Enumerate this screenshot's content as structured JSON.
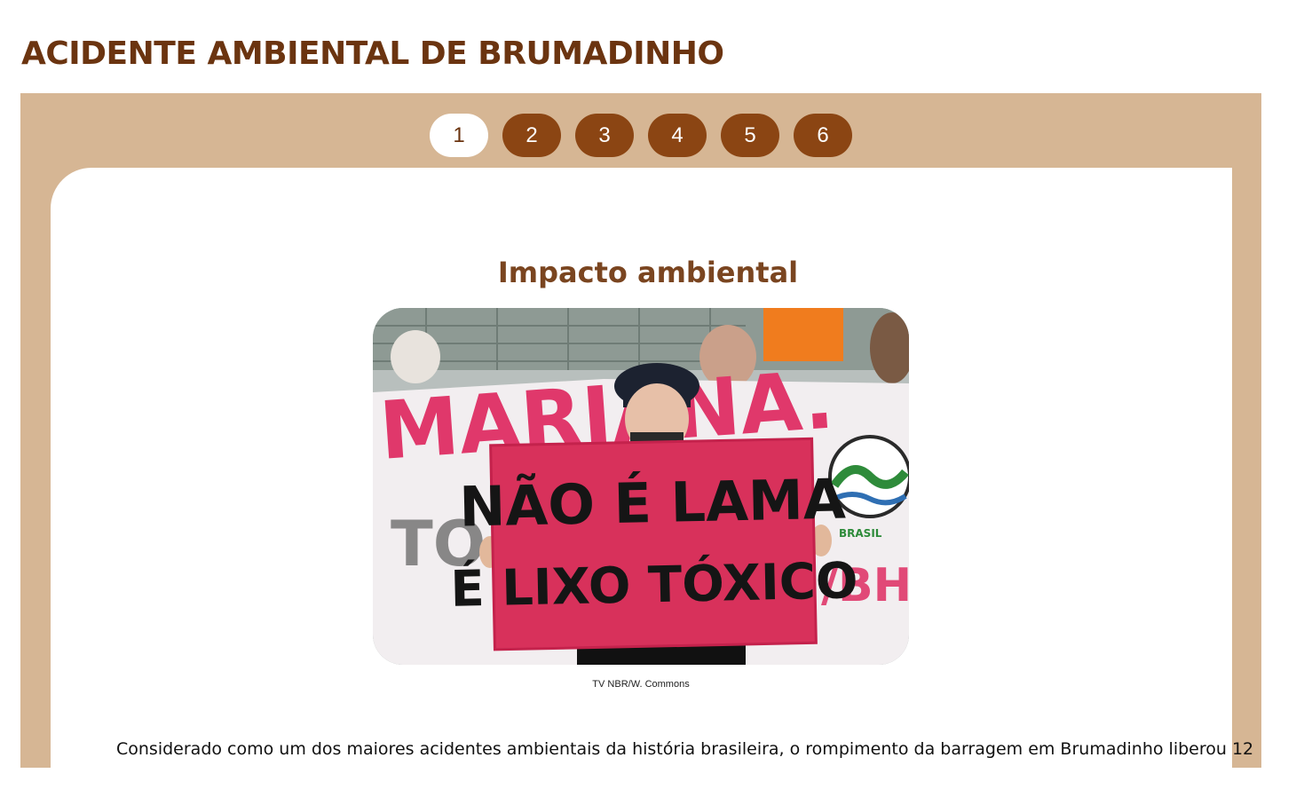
{
  "page": {
    "title": "ACIDENTE AMBIENTAL DE BRUMADINHO"
  },
  "pagination": {
    "pages": [
      "1",
      "2",
      "3",
      "4",
      "5",
      "6"
    ],
    "active": "1"
  },
  "slide": {
    "heading": "Impacto ambiental",
    "image": {
      "sign_line1": "NÃO É LAMA",
      "sign_line2": "É LIXO TÓXICO",
      "banner_text": "MARIANA.",
      "banner_right_text": "BRASIL"
    },
    "caption": "TV NBR/W. Commons",
    "body": "Considerado como um dos maiores acidentes ambientais da história brasileira, o rompimento da barragem em Brumadinho liberou 12"
  },
  "colors": {
    "title": "#6b3410",
    "frame": "#d6b694",
    "button": "#8b4513",
    "heading": "#7a4520",
    "sign": "#d8315b"
  }
}
